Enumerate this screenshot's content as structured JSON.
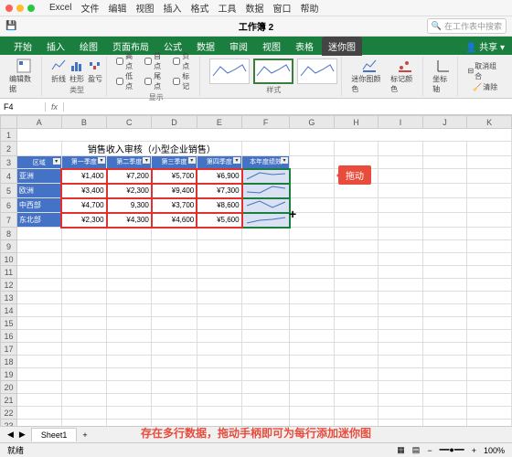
{
  "mac_menu": [
    "Excel",
    "文件",
    "编辑",
    "视图",
    "插入",
    "格式",
    "工具",
    "数据",
    "窗口",
    "帮助"
  ],
  "window_title": "工作簿 2",
  "search_placeholder": "在工作表中搜索",
  "ribbon_tabs": [
    "开始",
    "插入",
    "绘图",
    "页面布局",
    "公式",
    "数据",
    "审阅",
    "视图",
    "表格",
    "迷你图"
  ],
  "active_tab": "迷你图",
  "share_label": "共享",
  "ribbon": {
    "edit_data": "编辑数据",
    "types": [
      "折线",
      "柱形",
      "盈亏"
    ],
    "type_group": "类型",
    "checks": [
      {
        "label": "高点",
        "checked": false
      },
      {
        "label": "低点",
        "checked": false
      },
      {
        "label": "首点",
        "checked": false
      },
      {
        "label": "尾点",
        "checked": false
      },
      {
        "label": "负点",
        "checked": false
      },
      {
        "label": "标记",
        "checked": false
      }
    ],
    "check_group": "显示",
    "style_group": "样式",
    "spark_color": "迷你图颜色",
    "marker_color": "标记颜色",
    "axis": "坐标轴",
    "ungroup": "取消组合",
    "clear": "清除"
  },
  "name_box": "F4",
  "columns": [
    "A",
    "B",
    "C",
    "D",
    "E",
    "F",
    "G",
    "H",
    "I",
    "J",
    "K"
  ],
  "chart_data": {
    "type": "table",
    "title": "销售收入审核（小型企业销售）",
    "headers": [
      "区域",
      "第一季度",
      "第二季度",
      "第三季度",
      "第四季度",
      "本年度绩效"
    ],
    "rows": [
      {
        "region": "亚洲",
        "q": [
          "¥1,400",
          "¥7,200",
          "¥5,700",
          "¥6,900"
        ]
      },
      {
        "region": "欧洲",
        "q": [
          "¥3,400",
          "¥2,300",
          "¥9,400",
          "¥7,300"
        ]
      },
      {
        "region": "中西部",
        "q": [
          "¥4,700",
          "9,300",
          "¥3,700",
          "¥8,600"
        ]
      },
      {
        "region": "东北部",
        "q": [
          "¥2,300",
          "¥4,300",
          "¥4,600",
          "¥5,600"
        ]
      }
    ]
  },
  "callout_text": "拖动",
  "bottom_hint": "存在多行数据，拖动手柄即可为每行添加迷你图",
  "sheet_name": "Sheet1",
  "status": "就绪",
  "zoom": "100%"
}
